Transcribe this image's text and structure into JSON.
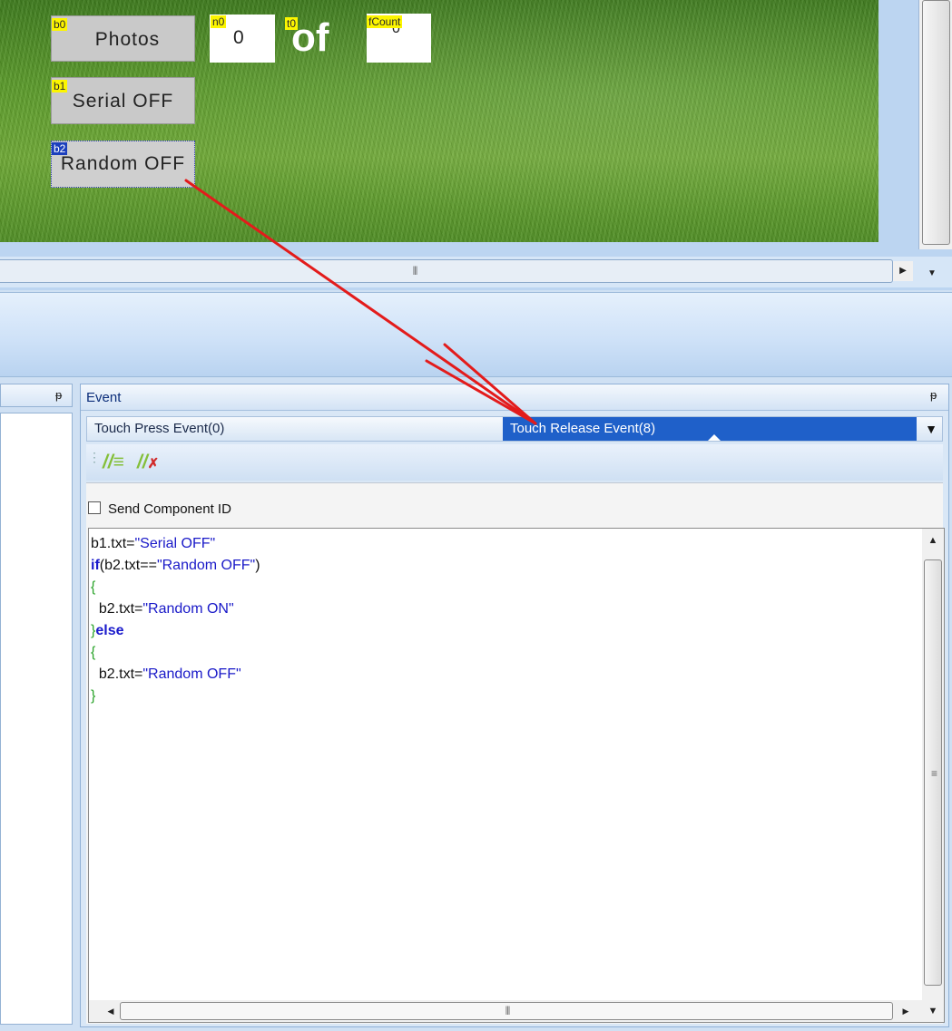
{
  "canvas": {
    "b0": {
      "tag": "b0",
      "text": "Photos"
    },
    "n0": {
      "tag": "n0",
      "value": "0"
    },
    "t0": {
      "tag": "t0",
      "text": "of"
    },
    "fCount": {
      "tag": "fCount",
      "value": "0"
    },
    "b1": {
      "tag": "b1",
      "text": "Serial OFF"
    },
    "b2": {
      "tag": "b2",
      "text": "Random OFF"
    }
  },
  "scroll": {
    "grip": "|||",
    "right_arrow": "▶",
    "down_arrow": "▼",
    "up_arrow": "▲",
    "left_arrow": "◀",
    "v_grip": "≡"
  },
  "left_panel": {
    "pin": "ᵽ"
  },
  "event_panel": {
    "title": "Event",
    "pin": "ᵽ",
    "tabs": [
      {
        "label": "Touch Press Event(0)"
      },
      {
        "label": "Touch Release Event(8)"
      }
    ],
    "dropdown": "▼",
    "toolbar": {
      "comment": "//≡",
      "uncomment": "//✗"
    },
    "send_component_id": "Send Component ID",
    "code": {
      "l1a": "b1.txt=",
      "l1b": "\"Serial OFF\"",
      "l2a": "if",
      "l2b": "(b2.txt==",
      "l2c": "\"Random OFF\"",
      "l2d": ")",
      "l3": "{",
      "l4a": "  b2.txt=",
      "l4b": "\"Random ON\"",
      "l5a": "}",
      "l5b": "else",
      "l6": "{",
      "l7a": "  b2.txt=",
      "l7b": "\"Random OFF\"",
      "l8": "}"
    }
  },
  "colors": {
    "arrow": "#e31b1b",
    "selected_tab": "#1f60c9",
    "tag": "#fcf500"
  }
}
